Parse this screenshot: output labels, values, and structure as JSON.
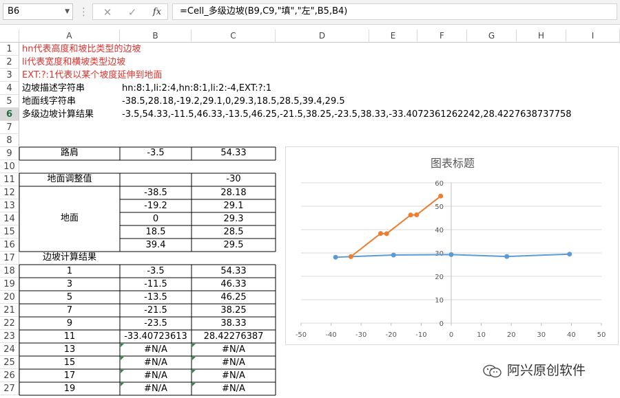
{
  "name_box": {
    "value": "B6"
  },
  "formula_bar": {
    "cancel_glyph": "✕",
    "enter_glyph": "✓",
    "fx_label": "fx",
    "formula": "=Cell_多级边坡(B9,C9,\"填\",\"左\",B5,B4)"
  },
  "columns": [
    "A",
    "B",
    "C",
    "D",
    "E",
    "F",
    "G",
    "H",
    "I"
  ],
  "rows": [
    "1",
    "2",
    "3",
    "4",
    "5",
    "6",
    "7",
    "8",
    "9",
    "10",
    "11",
    "12",
    "13",
    "14",
    "15",
    "16",
    "17",
    "18",
    "19",
    "20",
    "21",
    "22",
    "23",
    "24",
    "25",
    "26",
    "27"
  ],
  "selected_row": "6",
  "notes": {
    "r1": "hn代表高度和坡比类型的边坡",
    "r2": "li代表宽度和横坡类型边坡",
    "r3": "EXT:?:1代表以某个坡度延伸到地面"
  },
  "info": {
    "r4_label": "边坡描述字符串",
    "r4_value": "hn:8:1,li:2:4,hn:8:1,li:2:-4,EXT:?:1",
    "r5_label": "地面线字符串",
    "r5_value": "-38.5,28.18,-19.2,29.1,0,29.3,18.5,28.5,39.4,29.5",
    "r6_label": "多级边坡计算结果",
    "r6_value": "-3.5,54.33,-11.5,46.33,-13.5,46.25,-21.5,38.25,-23.5,38.33,-33.4072361262242,28.4227638737758"
  },
  "table": {
    "shoulder_label": "路肩",
    "shoulder_b": "-3.5",
    "shoulder_c": "54.33",
    "adjust_label": "地面调整值",
    "adjust_c": "-30",
    "ground_label": "地面",
    "ground_rows": [
      {
        "b": "-38.5",
        "c": "28.18"
      },
      {
        "b": "-19.2",
        "c": "29.1"
      },
      {
        "b": "0",
        "c": "29.3"
      },
      {
        "b": "18.5",
        "c": "28.5"
      },
      {
        "b": "39.4",
        "c": "29.5"
      }
    ],
    "result_label": "边坡计算结果",
    "result_rows": [
      {
        "a": "1",
        "b": "-3.5",
        "c": "54.33"
      },
      {
        "a": "3",
        "b": "-11.5",
        "c": "46.33"
      },
      {
        "a": "5",
        "b": "-13.5",
        "c": "46.25"
      },
      {
        "a": "7",
        "b": "-21.5",
        "c": "38.25"
      },
      {
        "a": "9",
        "b": "-23.5",
        "c": "38.33"
      },
      {
        "a": "11",
        "b": "-33.40723613",
        "c": "28.42276387"
      },
      {
        "a": "13",
        "b": "#N/A",
        "c": "#N/A"
      },
      {
        "a": "15",
        "b": "#N/A",
        "c": "#N/A"
      },
      {
        "a": "17",
        "b": "#N/A",
        "c": "#N/A"
      },
      {
        "a": "19",
        "b": "#N/A",
        "c": "#N/A"
      }
    ]
  },
  "chart_data": {
    "type": "scatter",
    "title": "图表标题",
    "xlim": [
      -50,
      50
    ],
    "ylim": [
      0,
      60
    ],
    "x_ticks": [
      "-50",
      "-40",
      "-30",
      "-20",
      "-10",
      "0",
      "10",
      "20",
      "30",
      "40",
      "50"
    ],
    "y_ticks": [
      "0",
      "10",
      "20",
      "30",
      "40",
      "50",
      "60"
    ],
    "grid": true,
    "series": [
      {
        "color": "#5b9bd5",
        "points": [
          [
            -38.5,
            28.18
          ],
          [
            -19.2,
            29.1
          ],
          [
            0,
            29.3
          ],
          [
            18.5,
            28.5
          ],
          [
            39.4,
            29.5
          ]
        ]
      },
      {
        "color": "#ed7d31",
        "points": [
          [
            -3.5,
            54.33
          ],
          [
            -11.5,
            46.33
          ],
          [
            -13.5,
            46.25
          ],
          [
            -21.5,
            38.25
          ],
          [
            -23.5,
            38.33
          ],
          [
            -33.4072,
            28.4228
          ]
        ]
      }
    ]
  },
  "watermark": {
    "text": "阿兴原创软件"
  }
}
